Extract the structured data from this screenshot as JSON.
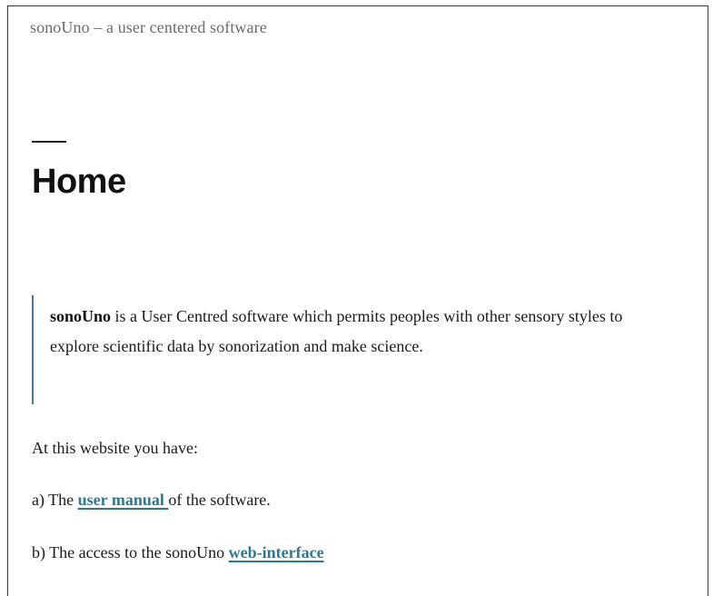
{
  "header": {
    "site_title": "sonoUno – a user centered software"
  },
  "page": {
    "title": "Home"
  },
  "intro": {
    "brand": "sonoUno",
    "text_line1": " is a User Centred software which permits peoples with other sensory styles to",
    "text_line2": "explore scientific data by sonorization and make science."
  },
  "content": {
    "lead": "At this website you have:",
    "item_a_prefix": "a) The ",
    "item_a_link": "user manual ",
    "item_a_suffix": "of the software.",
    "item_b_prefix": "b) The access to the sonoUno ",
    "item_b_link": "web-interface"
  },
  "colors": {
    "link": "#2b7a95",
    "quote_border": "#3f7ea0",
    "text": "#1a1a1a"
  }
}
